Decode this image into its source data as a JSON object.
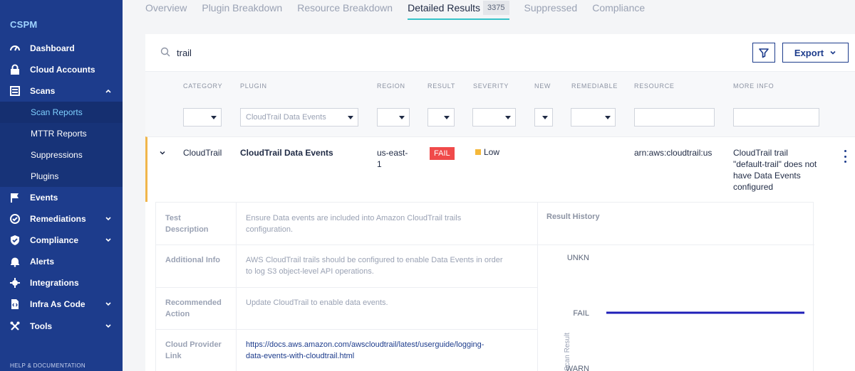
{
  "sidebar": {
    "brand": "CSPM",
    "items": [
      {
        "label": "Dashboard",
        "icon": "gauge-icon"
      },
      {
        "label": "Cloud Accounts",
        "icon": "cloud-lock-icon"
      },
      {
        "label": "Scans",
        "icon": "list-icon",
        "expanded": true
      },
      {
        "label": "Events",
        "icon": "flag-icon"
      },
      {
        "label": "Remediations",
        "icon": "wrench-check-icon"
      },
      {
        "label": "Compliance",
        "icon": "shield-check-icon"
      },
      {
        "label": "Alerts",
        "icon": "bell-icon"
      },
      {
        "label": "Integrations",
        "icon": "plug-icon"
      },
      {
        "label": "Infra As Code",
        "icon": "code-doc-icon"
      },
      {
        "label": "Tools",
        "icon": "tools-icon"
      }
    ],
    "sub_items": [
      "Scan Reports",
      "MTTR Reports",
      "Suppressions",
      "Plugins"
    ],
    "help": "HELP & DOCUMENTATION"
  },
  "tabs": [
    {
      "label": "Overview"
    },
    {
      "label": "Plugin Breakdown"
    },
    {
      "label": "Resource Breakdown"
    },
    {
      "label": "Detailed Results",
      "badge": "3375",
      "active": true
    },
    {
      "label": "Suppressed"
    },
    {
      "label": "Compliance"
    }
  ],
  "search": {
    "value": "trail"
  },
  "toolbar": {
    "export_label": "Export"
  },
  "columns": [
    "CATEGORY",
    "PLUGIN",
    "REGION",
    "RESULT",
    "SEVERITY",
    "NEW",
    "REMEDIABLE",
    "RESOURCE",
    "MORE INFO"
  ],
  "filters": {
    "plugin_selected": "CloudTrail Data Events"
  },
  "row": {
    "category": "CloudTrail",
    "plugin": "CloudTrail Data Events",
    "region_line1": "us-east-",
    "region_line2": "1",
    "result": "FAIL",
    "severity": "Low",
    "resource": "arn:aws:cloudtrail:us",
    "more_info": [
      "CloudTrail trail",
      "\"default-trail\" does not",
      "have Data Events",
      "configured"
    ]
  },
  "detail": {
    "test_description_label": [
      "Test",
      "Description"
    ],
    "test_description": [
      "Ensure Data events are included into Amazon CloudTrail trails",
      "configuration."
    ],
    "additional_info_label": "Additional Info",
    "additional_info": [
      "AWS CloudTrail trails should be configured to enable Data Events in order",
      "to log S3 object-level API operations."
    ],
    "recommended_action_label": [
      "Recommended",
      "Action"
    ],
    "recommended_action": "Update CloudTrail to enable data events.",
    "cloud_provider_link_label": [
      "Cloud Provider",
      "Link"
    ],
    "cloud_provider_link": [
      "https://docs.aws.amazon.com/awscloudtrail/latest/userguide/logging-",
      "data-events-with-cloudtrail.html"
    ],
    "result_history_title": "Result History"
  },
  "chart_data": {
    "type": "line",
    "categories": [
      "UNKN",
      "FAIL",
      "WARN"
    ],
    "ylabel": "Scan Result",
    "series": [
      {
        "values": [
          "FAIL",
          "FAIL"
        ]
      }
    ]
  },
  "colors": {
    "sidebar": "#1d3c8c",
    "accent": "#35c2c8",
    "fail": "#f04a4a",
    "low": "#f5b839",
    "row_marker": "#f0b64b"
  }
}
